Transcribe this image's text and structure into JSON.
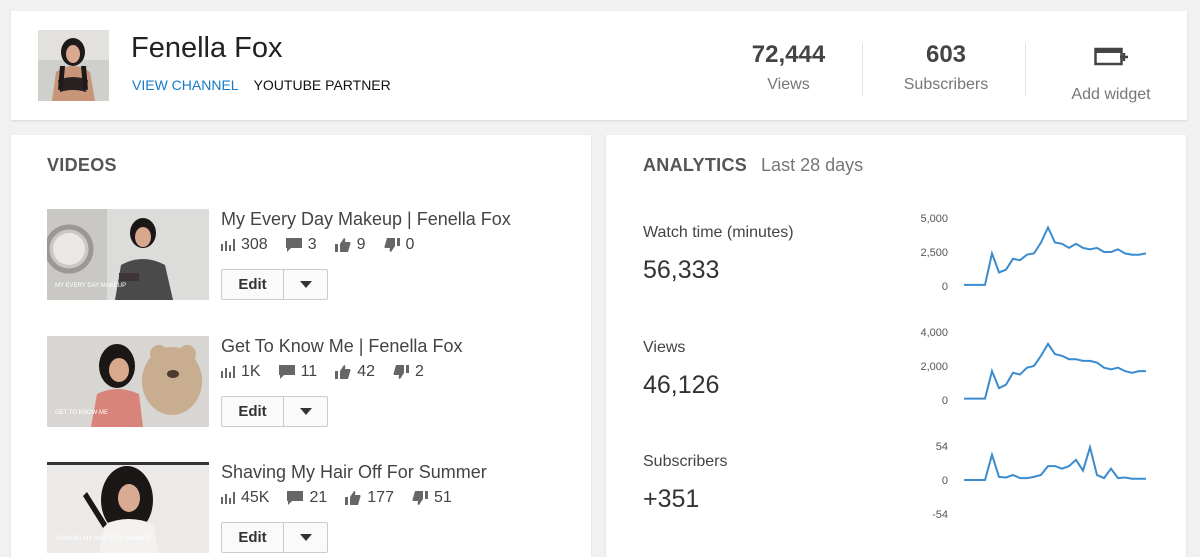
{
  "header": {
    "channel_name": "Fenella Fox",
    "view_channel": "VIEW CHANNEL",
    "partner": "YOUTUBE PARTNER",
    "views_value": "72,444",
    "views_label": "Views",
    "subscribers_value": "603",
    "subscribers_label": "Subscribers",
    "widget_label": "Add widget"
  },
  "videos": {
    "title": "VIDEOS",
    "edit_label": "Edit",
    "items": [
      {
        "title": "My Every Day Makeup | Fenella Fox",
        "views": "308",
        "comments": "3",
        "likes": "9",
        "dislikes": "0",
        "thumb_caption": "MY EVERY DAY MAKEUP"
      },
      {
        "title": "Get To Know Me | Fenella Fox",
        "views": "1K",
        "comments": "11",
        "likes": "42",
        "dislikes": "2",
        "thumb_caption": "GET TO KNOW ME"
      },
      {
        "title": "Shaving My Hair Off For Summer",
        "views": "45K",
        "comments": "21",
        "likes": "177",
        "dislikes": "51",
        "thumb_caption": "SHAVING MY HAIR FOR SUMMER"
      }
    ]
  },
  "analytics": {
    "title": "ANALYTICS",
    "range": "Last 28 days",
    "metrics": [
      {
        "label": "Watch time (minutes)",
        "value": "56,333"
      },
      {
        "label": "Views",
        "value": "46,126"
      },
      {
        "label": "Subscribers",
        "value": "+351"
      }
    ]
  },
  "colors": {
    "accent": "#167ac6",
    "line": "#3a8ccf"
  },
  "chart_data": [
    {
      "type": "line",
      "ylim": [
        0,
        5000
      ],
      "yticks": [
        "5,000",
        "2,500",
        "0"
      ],
      "values": [
        80,
        80,
        80,
        80,
        2400,
        1000,
        1200,
        2000,
        1900,
        2300,
        2400,
        3200,
        4300,
        3200,
        3100,
        2800,
        3100,
        2800,
        2700,
        2800,
        2500,
        2500,
        2700,
        2400,
        2300,
        2300,
        2400
      ]
    },
    {
      "type": "line",
      "ylim": [
        0,
        4000
      ],
      "yticks": [
        "4,000",
        "2,000",
        "0"
      ],
      "values": [
        80,
        80,
        80,
        80,
        1700,
        700,
        900,
        1600,
        1500,
        1900,
        2000,
        2600,
        3300,
        2700,
        2600,
        2400,
        2400,
        2300,
        2300,
        2200,
        1900,
        1800,
        1900,
        1700,
        1600,
        1700,
        1700
      ]
    },
    {
      "type": "line",
      "ylim": [
        -54,
        54
      ],
      "yticks": [
        "54",
        "0",
        "-54"
      ],
      "values": [
        0,
        0,
        0,
        0,
        40,
        5,
        4,
        8,
        3,
        3,
        5,
        8,
        22,
        22,
        18,
        22,
        32,
        15,
        52,
        8,
        3,
        18,
        3,
        4,
        2,
        2,
        2
      ]
    }
  ]
}
